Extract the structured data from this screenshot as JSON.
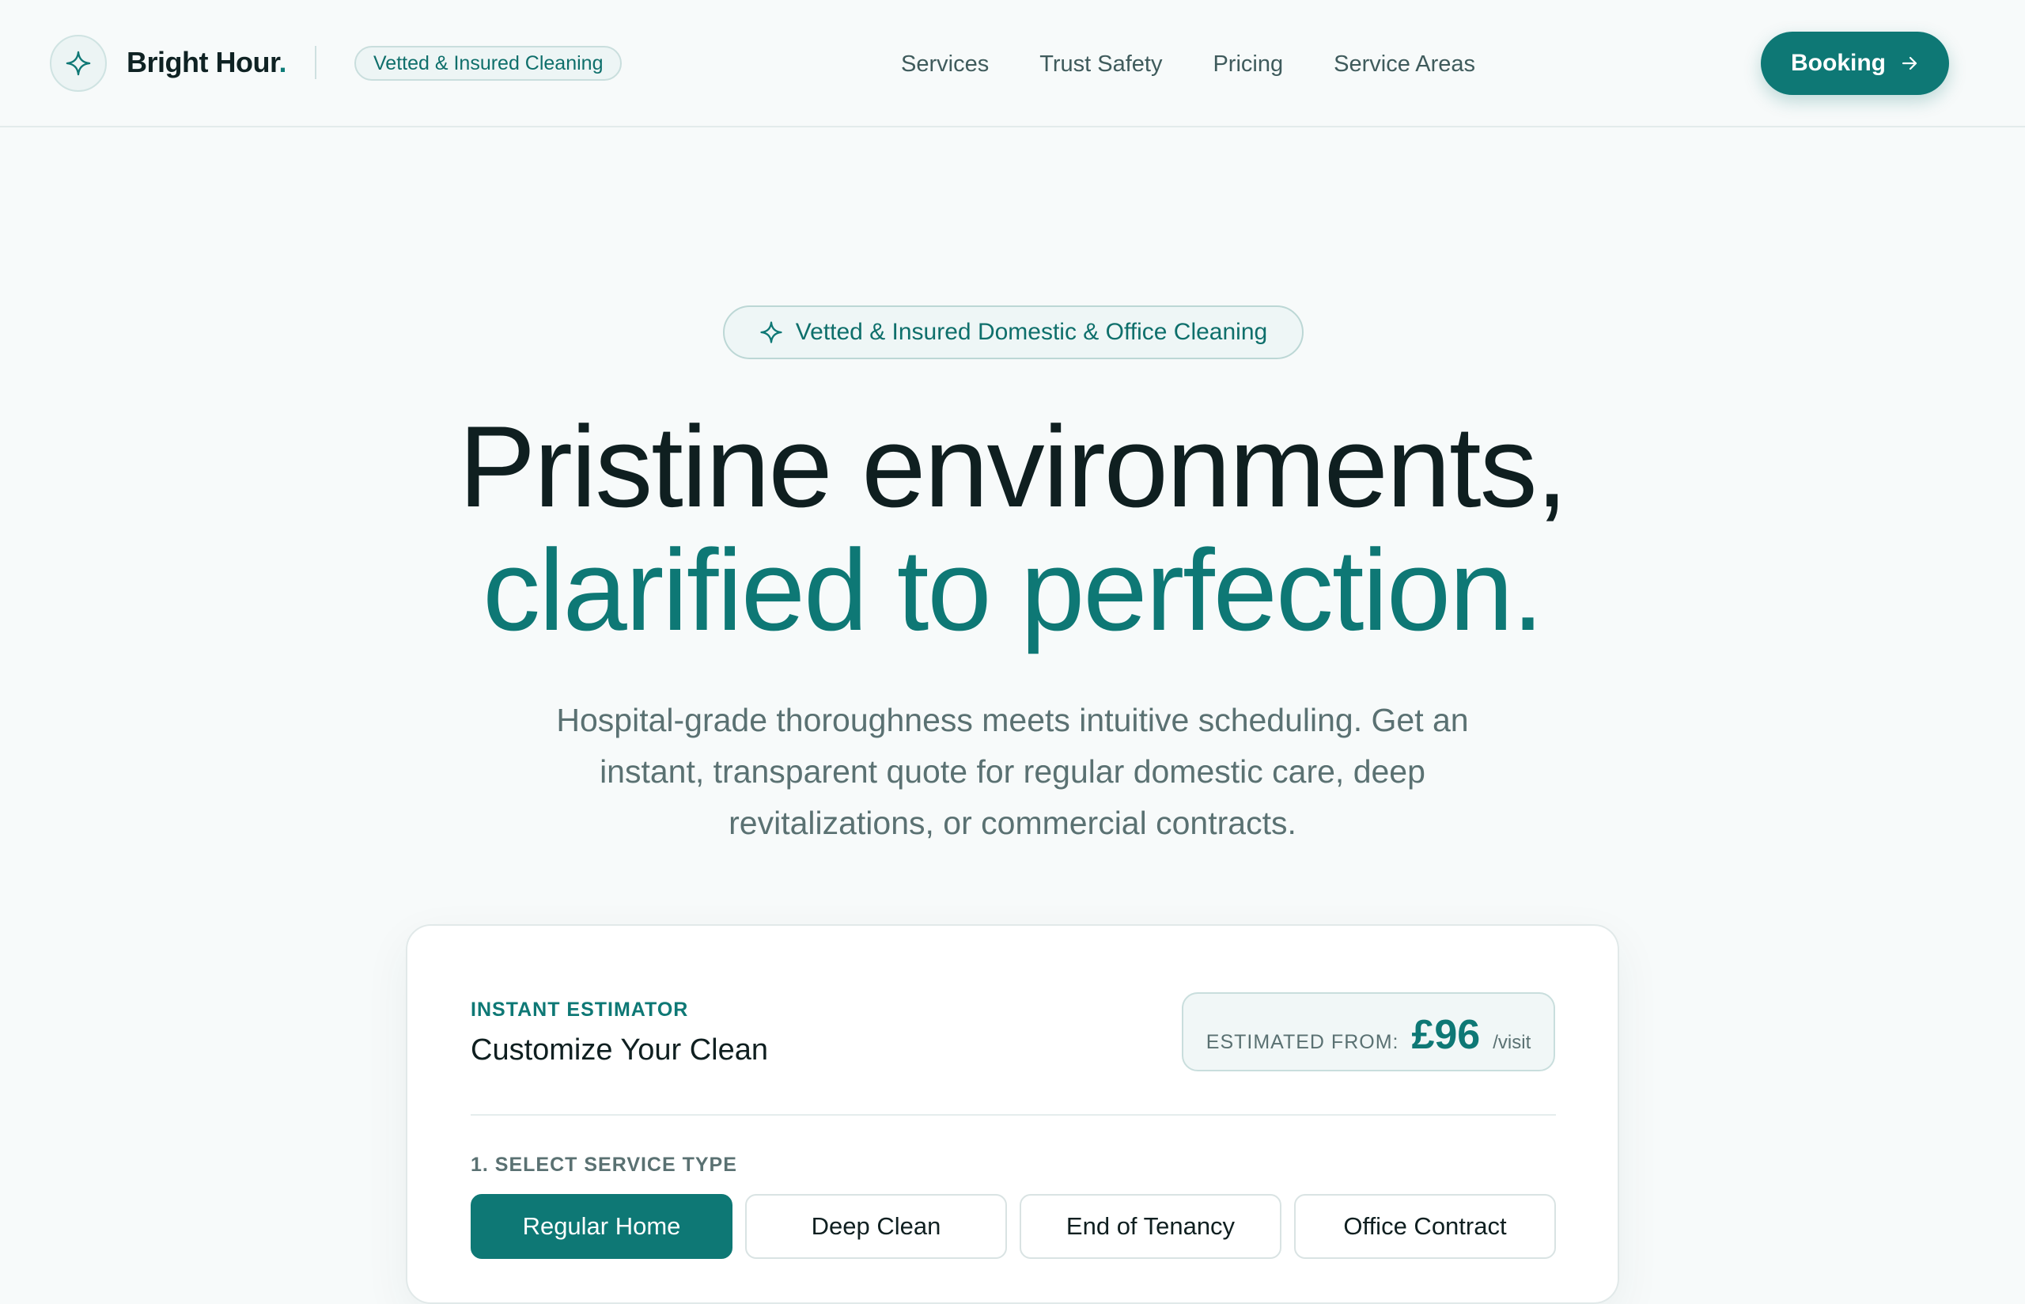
{
  "header": {
    "brand_name": "Bright Hour",
    "brand_dot": ".",
    "badge": "Vetted & Insured Cleaning",
    "nav": [
      "Services",
      "Trust Safety",
      "Pricing",
      "Service Areas"
    ],
    "cta_label": "Booking",
    "icons": {
      "logo": "sparkle-icon",
      "cta": "arrow-right-icon"
    }
  },
  "hero": {
    "pill": "Vetted & Insured Domestic & Office Cleaning",
    "title_line1": "Pristine environments,",
    "title_line2": "clarified to perfection.",
    "subtitle": "Hospital-grade thoroughness meets intuitive scheduling. Get an instant, transparent quote for regular domestic care, deep revitalizations, or commercial contracts."
  },
  "estimator": {
    "eyebrow": "INSTANT ESTIMATOR",
    "title": "Customize Your Clean",
    "estimate_label": "ESTIMATED FROM:",
    "estimate_price": "£96",
    "estimate_unit": "/visit",
    "step1_label": "1. SELECT SERVICE TYPE",
    "service_types": [
      "Regular Home",
      "Deep Clean",
      "End of Tenancy",
      "Office Contract"
    ],
    "selected_service": "Regular Home"
  },
  "colors": {
    "accent": "#0e7875",
    "background": "#f7fafa",
    "heading": "#0f1f20",
    "muted": "#5a7172"
  }
}
